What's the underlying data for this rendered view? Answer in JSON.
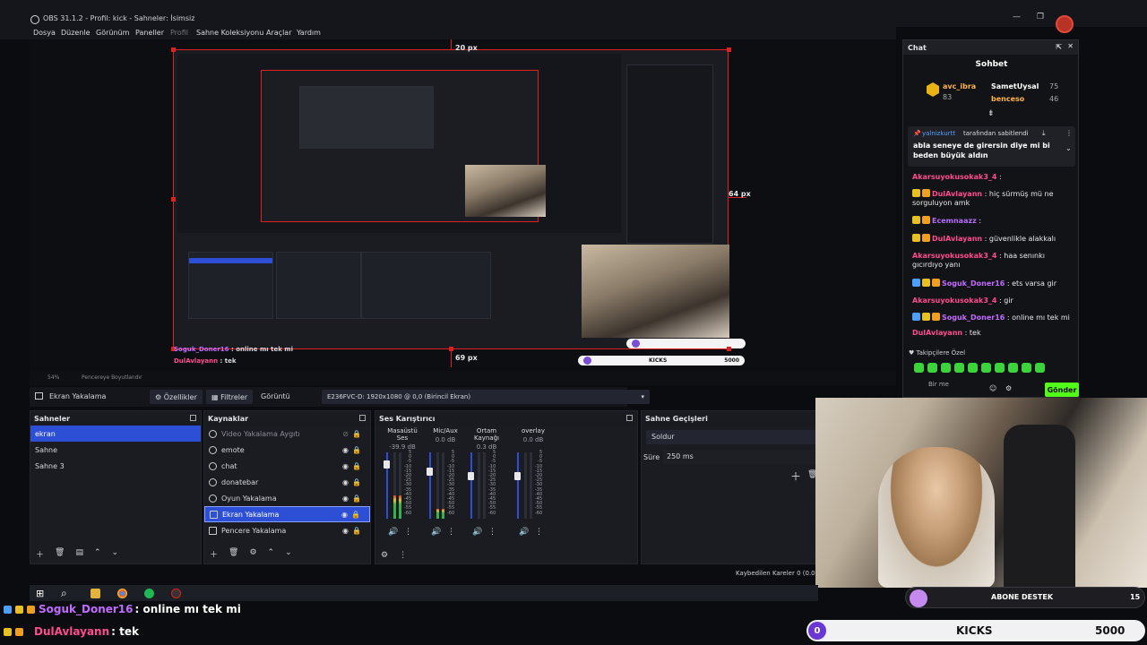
{
  "titlebar": {
    "title": "OBS 31.1.2 - Profil: kick - Sahneler: İsimsiz"
  },
  "menu": [
    "Dosya",
    "Düzenle",
    "Görünüm",
    "Paneller",
    "Profil",
    "Sahne Koleksiyonu",
    "Araçlar",
    "Yardım"
  ],
  "preview": {
    "top_px": "20 px",
    "right_px": "64 px",
    "bottom_px": "69 px",
    "kicks_label": "KICKS",
    "kicks_value": "5000",
    "chat_line1_user": "Soguk_Doner16",
    "chat_line1_text": " : online mı tek mi",
    "chat_line2_user": "DulAvlayann",
    "chat_line2_text": " : tek"
  },
  "zoom": {
    "value": "54%",
    "fit": "Pencereye Boyutlandır"
  },
  "sourcebar": {
    "source_name": "Ekran Yakalama",
    "properties": "Özellikler",
    "filters": "Filtreler",
    "display_label": "Görüntü",
    "display_value": "E236FVC-D: 1920x1080 @ 0,0 (Birincil Ekran)"
  },
  "scenes": {
    "title": "Sahneler",
    "items": [
      "ekran",
      "Sahne",
      "Sahne 3"
    ]
  },
  "sources": {
    "title": "Kaynaklar",
    "items": [
      "Video Yakalama Aygıtı",
      "emote",
      "chat",
      "donatebar",
      "Oyun Yakalama",
      "Ekran Yakalama",
      "Pencere Yakalama"
    ]
  },
  "mixer": {
    "title": "Ses Karıştırıcı",
    "channels": [
      {
        "name": "Masaüstü Ses",
        "db": "-39.9 dB",
        "level": 0.35
      },
      {
        "name": "Mic/Aux",
        "db": "0.0 dB",
        "level": 0.15
      },
      {
        "name": "Ortam Kaynağı",
        "db": "0.3 dB",
        "level": 0.0
      },
      {
        "name": "overlay",
        "db": "0.0 dB",
        "level": 0.0
      }
    ],
    "ticks": [
      "5",
      "0",
      "-5",
      "-10",
      "-15",
      "-20",
      "-25",
      "-30",
      "-35",
      "-40",
      "-45",
      "-50",
      "-55",
      "-60"
    ]
  },
  "transitions": {
    "title": "Sahne Geçişleri",
    "type": "Soldur",
    "duration_label": "Süre",
    "duration_value": "250 ms"
  },
  "statusbar": {
    "dropped": "Kaybedilen Kareler 0 (0.0"
  },
  "chat": {
    "title": "Chat",
    "header": "Sohbet",
    "top_users": [
      {
        "name": "avc_ibra",
        "count": "83"
      },
      {
        "name": "SametUysal",
        "count": "75"
      },
      {
        "name": "benceso",
        "count": "46"
      }
    ],
    "pinned_by": "yalnizkurtt",
    "pinned_suffix": "tarafından sabitlendi",
    "pinned_text": "abla seneye de girersin diye mi bi beden büyük aldın",
    "messages": [
      {
        "user": "Akarsuyokusokak3_4",
        "text": ":",
        "cls": "u-pink"
      },
      {
        "user": "DulAvlayann",
        "text": ": hiç sürmüş mü ne sorguluyon amk",
        "cls": "u-pink"
      },
      {
        "user": "Ecemnaazz",
        "text": ":",
        "cls": "u-violet"
      },
      {
        "user": "DulAvlayann",
        "text": ": güvenlikle alakkalı",
        "cls": "u-pink"
      },
      {
        "user": "Akarsuyokusokak3_4",
        "text": ": haa senınkı gıcırdıyo yanı",
        "cls": "u-pink"
      },
      {
        "user": "Soguk_Doner16",
        "text": ": ets varsa gir",
        "cls": "u-purple"
      },
      {
        "user": "Akarsuyokusokak3_4",
        "text": ": gir",
        "cls": "u-pink"
      },
      {
        "user": "Soguk_Doner16",
        "text": ": online mı tek mi",
        "cls": "u-purple"
      },
      {
        "user": "DulAvlayann",
        "text": ": tek",
        "cls": "u-pink"
      }
    ],
    "followers_label": "Takipçilere Özel",
    "input_placeholder": "Bir me",
    "send": "Gönder"
  },
  "overlay": {
    "msg1_user": "Soguk_Doner16",
    "msg1_text": " : online mı tek mi",
    "msg2_user": "DulAvlayann",
    "msg2_text": " : tek",
    "abone_label": "ABONE DESTEK",
    "abone_value": "15",
    "kicks_zero": "0",
    "kicks_label": "KICKS",
    "kicks_value": "5000"
  },
  "colors": {
    "accent": "#2d4fd6",
    "kick_green": "#53fc18",
    "red_outline": "#e02020"
  }
}
